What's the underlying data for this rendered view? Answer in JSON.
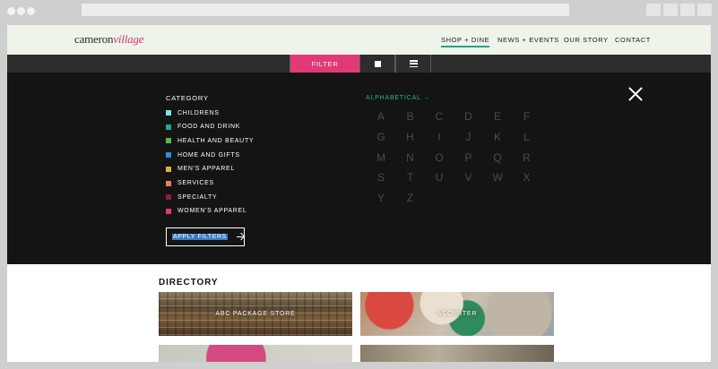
{
  "brand": {
    "part1": "cameron",
    "part2": "village"
  },
  "nav": {
    "items": [
      {
        "label": "SHOP + DINE",
        "active": true
      },
      {
        "label": "NEWS + EVENTS",
        "active": false
      },
      {
        "label": "OUR STORY",
        "active": false
      },
      {
        "label": "CONTACT",
        "active": false
      }
    ],
    "active_underline_color": "#1fa48f"
  },
  "filter_bar": {
    "filter_label": "FILTER",
    "filter_color": "#e23a76",
    "grid_view_icon": "grid-square-icon",
    "list_view_icon": "list-lines-icon"
  },
  "filter_panel": {
    "category_title": "CATEGORY",
    "categories": [
      {
        "label": "CHILDRENS",
        "color": "#7fe3e3"
      },
      {
        "label": "FOOD AND DRINK",
        "color": "#24a88f"
      },
      {
        "label": "HEALTH AND BEAUTY",
        "color": "#57b847"
      },
      {
        "label": "HOME AND GIFTS",
        "color": "#2c8fd6"
      },
      {
        "label": "MEN'S APPAREL",
        "color": "#d8b235"
      },
      {
        "label": "SERVICES",
        "color": "#ef7c5c"
      },
      {
        "label": "SPECIALTY",
        "color": "#8a1f4f"
      },
      {
        "label": "WOMEN'S APPAREL",
        "color": "#de3b70"
      }
    ],
    "apply_label": "APPLY FILTERS",
    "alphabetical_label": "ALPHABETICAL →",
    "letters": [
      "A",
      "B",
      "C",
      "D",
      "E",
      "F",
      "G",
      "H",
      "I",
      "J",
      "K",
      "L",
      "M",
      "N",
      "O",
      "P",
      "Q",
      "R",
      "S",
      "T",
      "U",
      "V",
      "W",
      "X",
      "Y",
      "Z"
    ],
    "close_icon": "close-x-icon"
  },
  "directory": {
    "title": "DIRECTORY",
    "cards": [
      {
        "label": "ABC PACKAGE STORE"
      },
      {
        "label": "ACCIPITER"
      }
    ]
  }
}
